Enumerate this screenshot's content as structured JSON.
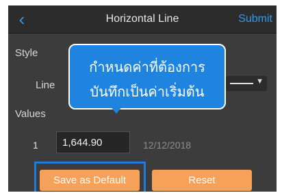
{
  "header": {
    "back_icon": "chevron-left-icon",
    "title": "Horizontal Line",
    "submit_label": "Submit"
  },
  "style": {
    "section_label": "Style",
    "line_label": "Line",
    "line_select_icon": "caret-down-icon"
  },
  "values": {
    "section_label": "Values",
    "rows": [
      {
        "index": "1",
        "value": "1,644.90",
        "date": "12/12/2018"
      }
    ]
  },
  "buttons": {
    "save_default_label": "Save as Default",
    "reset_label": "Reset"
  },
  "tooltip": {
    "line1": "กำหนดค่าที่ต้องการ",
    "line2": "บันทึกเป็นค่าเริ่มต้น"
  },
  "colors": {
    "accent": "#2f9bea",
    "button": "#f5a15a",
    "highlight": "#1f7bd6",
    "tooltip": "#1f84e0",
    "panel": "#3c3c3c"
  }
}
